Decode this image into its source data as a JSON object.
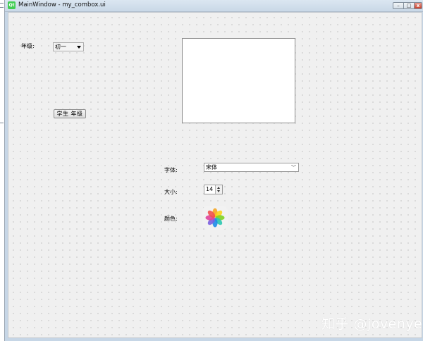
{
  "window": {
    "title": "MainWindow - my_combox.ui",
    "logo": "Qt",
    "controls": {
      "minimize": "–",
      "maximize": "□",
      "close": "x"
    }
  },
  "form": {
    "grade_label": "年级:",
    "grade_combo": {
      "value": "初一",
      "icon": "triangle-down-icon"
    },
    "student_grade_button": "学生 年级",
    "font_label": "字体:",
    "font_combo": {
      "value": "宋体",
      "icon": "chevron-down-icon"
    },
    "size_label": "大小:",
    "size_spin": {
      "value": "14"
    },
    "color_label": "颜色:",
    "color_icon": "photos-flower-icon"
  },
  "watermark": "知乎 @jovenye"
}
